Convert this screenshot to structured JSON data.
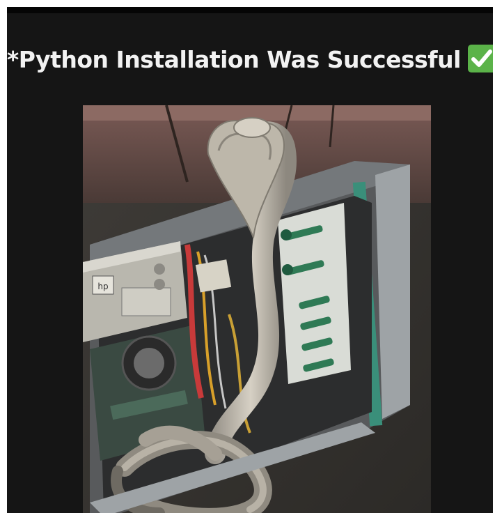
{
  "caption": {
    "text": "*Python Installation Was Successful",
    "emoji_icon": "check-mark-button-icon"
  },
  "colors": {
    "background": "#151515",
    "caption_text": "#f2f2f2",
    "check_green": "#5bb349"
  }
}
